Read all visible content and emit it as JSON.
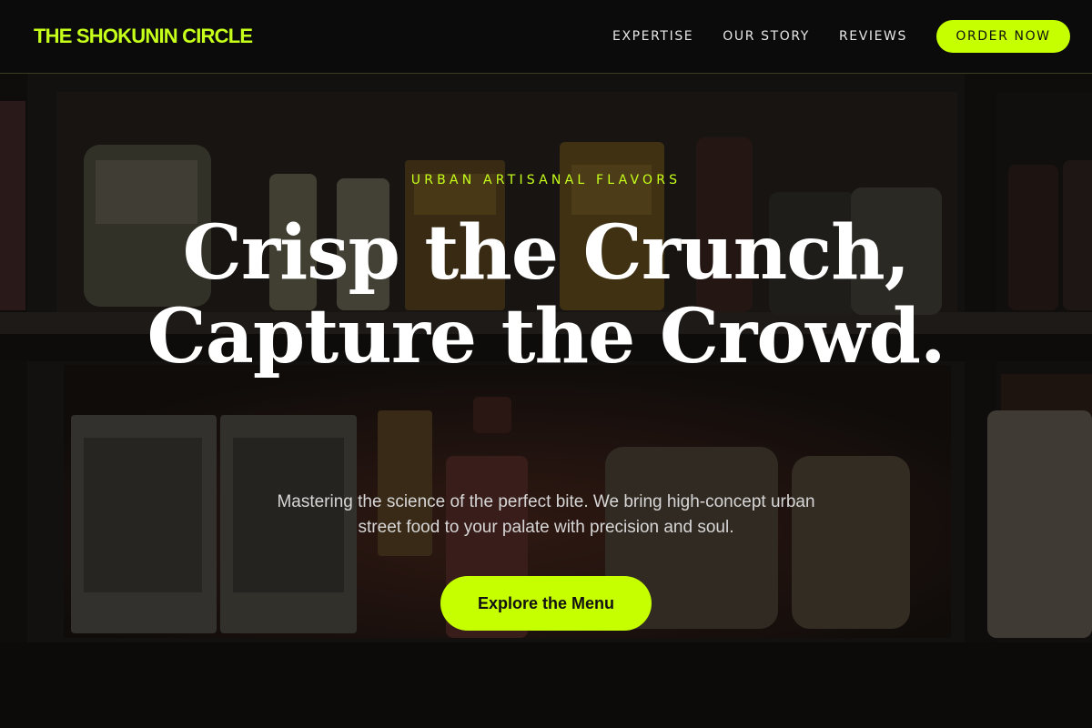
{
  "nav": {
    "brand": "THE SHOKUNIN CIRCLE",
    "links": [
      "EXPERTISE",
      "OUR STORY",
      "REVIEWS"
    ],
    "cta": "ORDER NOW"
  },
  "hero": {
    "eyebrow": "URBAN ARTISANAL FLAVORS",
    "headline": "Crisp the Crunch, Capture the Crowd.",
    "subtext": "Mastering the science of the perfect bite. We bring high-concept urban street food to your palate with precision and soul.",
    "cta": "Explore the Menu",
    "background_image": "pantry-shelf-photo"
  },
  "colors": {
    "accent": "#c6ff00",
    "nav_bg": "#0b0b0b",
    "text": "#ffffff",
    "muted_text": "#d6d6d6"
  }
}
